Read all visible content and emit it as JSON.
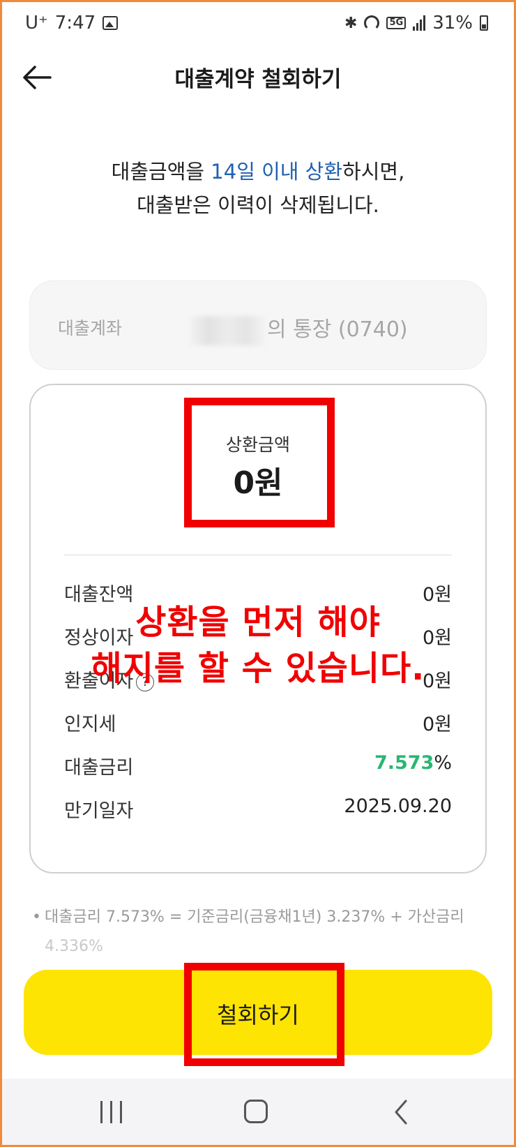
{
  "status_bar": {
    "carrier": "U⁺",
    "time": "7:47",
    "network": "5G",
    "battery": "31%"
  },
  "header": {
    "title": "대출계약 철회하기"
  },
  "intro": {
    "prefix": "대출금액을 ",
    "highlight": "14일 이내 상환",
    "suffix": "하시면,",
    "line2": "대출받은 이력이 삭제됩니다."
  },
  "account": {
    "label": "대출계좌",
    "value": "의 통장 (0740)"
  },
  "repayment": {
    "label": "상환금액",
    "amount": "0원"
  },
  "details": [
    {
      "label": "대출잔액",
      "value": "0원"
    },
    {
      "label": "정상이자",
      "value": "0원"
    },
    {
      "label": "환출이자",
      "value": "0원"
    },
    {
      "label": "인지세",
      "value": "0원"
    }
  ],
  "rate": {
    "label": "대출금리",
    "number": "7.573",
    "unit": "%"
  },
  "maturity": {
    "label": "만기일자",
    "value": "2025.09.20"
  },
  "note": {
    "bullet": "•",
    "line1": "대출금리 7.573% = 기준금리(금융채1년) 3.237% + 가산금리",
    "line2": "4.336%"
  },
  "actions": {
    "withdraw_label": "철회하기"
  },
  "annotation": {
    "line1": "상환을 먼저 해야",
    "line2": "해지를 할 수 있습니다.",
    "color": "#f00000"
  },
  "colors": {
    "accent_yellow": "#fde402",
    "highlight_blue": "#1f5fb0",
    "rate_green": "#2bb673",
    "frame_orange": "#f08a3c"
  }
}
